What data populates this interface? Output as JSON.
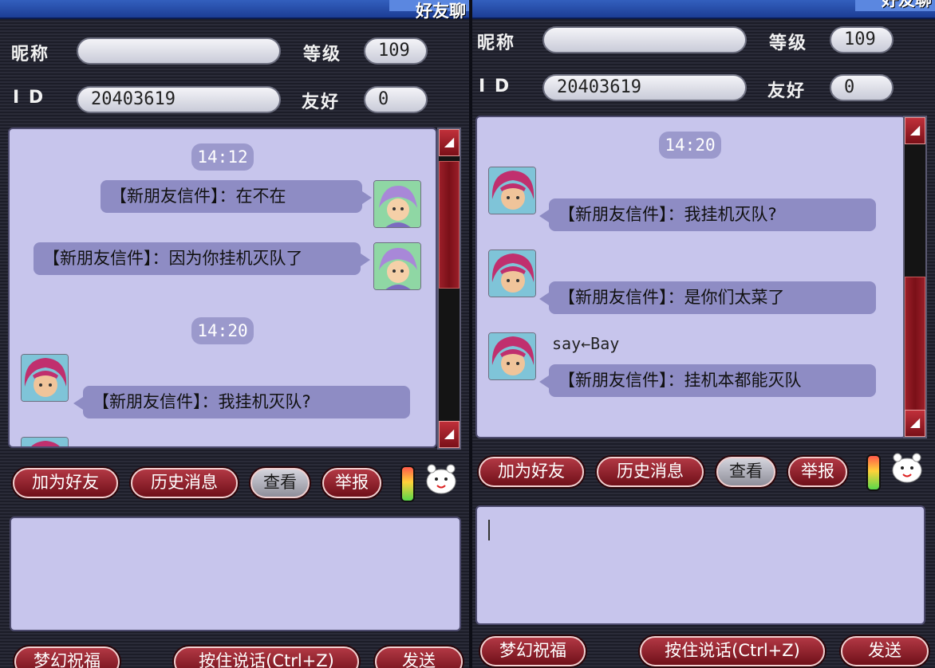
{
  "left": {
    "title": "好友聊",
    "profile": {
      "nickname_label": "昵称",
      "nickname_value": "",
      "level_label": "等级",
      "level_value": "109",
      "id_label": "I D",
      "id_value": "20403619",
      "friendship_label": "友好",
      "friendship_value": "0"
    },
    "messages": [
      {
        "type": "time",
        "text": "14:12"
      },
      {
        "type": "sent",
        "text": "【新朋友信件】：在不在"
      },
      {
        "type": "sent",
        "text": "【新朋友信件】：因为你挂机灭队了"
      },
      {
        "type": "time",
        "text": "14:20"
      },
      {
        "type": "received",
        "text": "【新朋友信件】：我挂机灭队?"
      }
    ],
    "actions": {
      "add_friend": "加为好友",
      "history": "历史消息",
      "view": "查看",
      "report": "举报"
    },
    "bottom": {
      "blessing": "梦幻祝福",
      "push_to_talk": "按住说话(Ctrl+Z)",
      "send": "发送"
    }
  },
  "right": {
    "title": "好友聊",
    "profile": {
      "nickname_label": "昵称",
      "nickname_value": "",
      "level_label": "等级",
      "level_value": "109",
      "id_label": "I D",
      "id_value": "20403619",
      "friendship_label": "友好",
      "friendship_value": "0"
    },
    "messages": [
      {
        "type": "time",
        "text": "14:20"
      },
      {
        "type": "received",
        "text": "【新朋友信件】：我挂机灭队?"
      },
      {
        "type": "received",
        "text": "【新朋友信件】：是你们太菜了"
      },
      {
        "type": "received",
        "sender": "say←Bay",
        "text": "【新朋友信件】：挂机本都能灭队"
      }
    ],
    "actions": {
      "add_friend": "加为好友",
      "history": "历史消息",
      "view": "查看",
      "report": "举报"
    },
    "bottom": {
      "blessing": "梦幻祝福",
      "push_to_talk": "按住说话(Ctrl+Z)",
      "send": "发送"
    }
  },
  "colors": {
    "chat_bg": "#c7c5ec",
    "bubble": "#8e8cc4",
    "button_red": "#8e1b26",
    "title_blue": "#2a52b8"
  }
}
